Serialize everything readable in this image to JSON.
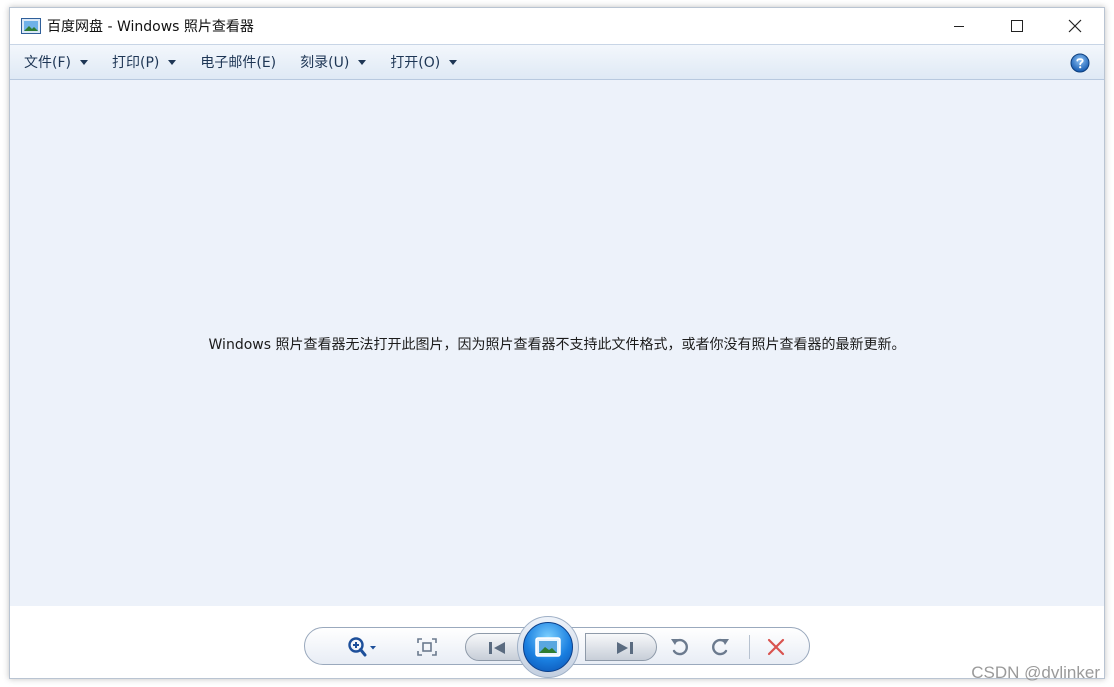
{
  "window": {
    "title": "百度网盘 - Windows 照片查看器"
  },
  "menu": {
    "items": [
      {
        "label": "文件(F)",
        "has_dropdown": true
      },
      {
        "label": "打印(P)",
        "has_dropdown": true
      },
      {
        "label": "电子邮件(E)",
        "has_dropdown": false
      },
      {
        "label": "刻录(U)",
        "has_dropdown": true
      },
      {
        "label": "打开(O)",
        "has_dropdown": true
      }
    ]
  },
  "content": {
    "message": "Windows 照片查看器无法打开此图片，因为照片查看器不支持此文件格式，或者你没有照片查看器的最新更新。"
  },
  "toolbar": {
    "icons": [
      "zoom-icon",
      "actual-size-icon",
      "previous-icon",
      "slideshow-icon",
      "next-icon",
      "rotate-left-icon",
      "rotate-right-icon",
      "delete-icon"
    ]
  },
  "watermark": "CSDN @dvlinker",
  "colors": {
    "content_bg": "#edf2fa",
    "menubar_bg": "#dfe9f5",
    "menu_text": "#1e3655",
    "delete_red": "#d9534f",
    "slideshow_blue": "#1a7fe0"
  }
}
